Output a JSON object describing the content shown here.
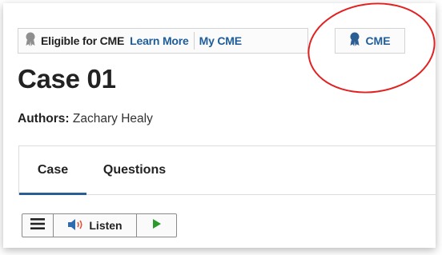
{
  "cme": {
    "eligible_label": "Eligible for CME",
    "learn_more_label": "Learn More",
    "my_cme_label": "My CME",
    "cme_button_label": "CME"
  },
  "case": {
    "title": "Case 01",
    "authors_prefix": "Authors:",
    "authors_names": "Zachary Healy"
  },
  "tabs": [
    {
      "label": "Case",
      "active": true
    },
    {
      "label": "Questions",
      "active": false
    }
  ],
  "toolbar": {
    "listen_label": "Listen"
  },
  "icons": {
    "ribbon_gray": "award-ribbon-icon",
    "ribbon_blue": "award-ribbon-icon",
    "menu": "hamburger-menu-icon",
    "speaker": "speaker-icon",
    "play": "play-icon"
  },
  "colors": {
    "link": "#1f5d9a",
    "ribbon_gray": "#8e8e8e",
    "tab_underline": "#2a5e95",
    "speaker": "#2f6bb0",
    "speaker_waves": "#e0533a",
    "play": "#2a9a2a",
    "annotation": "#e32020"
  }
}
